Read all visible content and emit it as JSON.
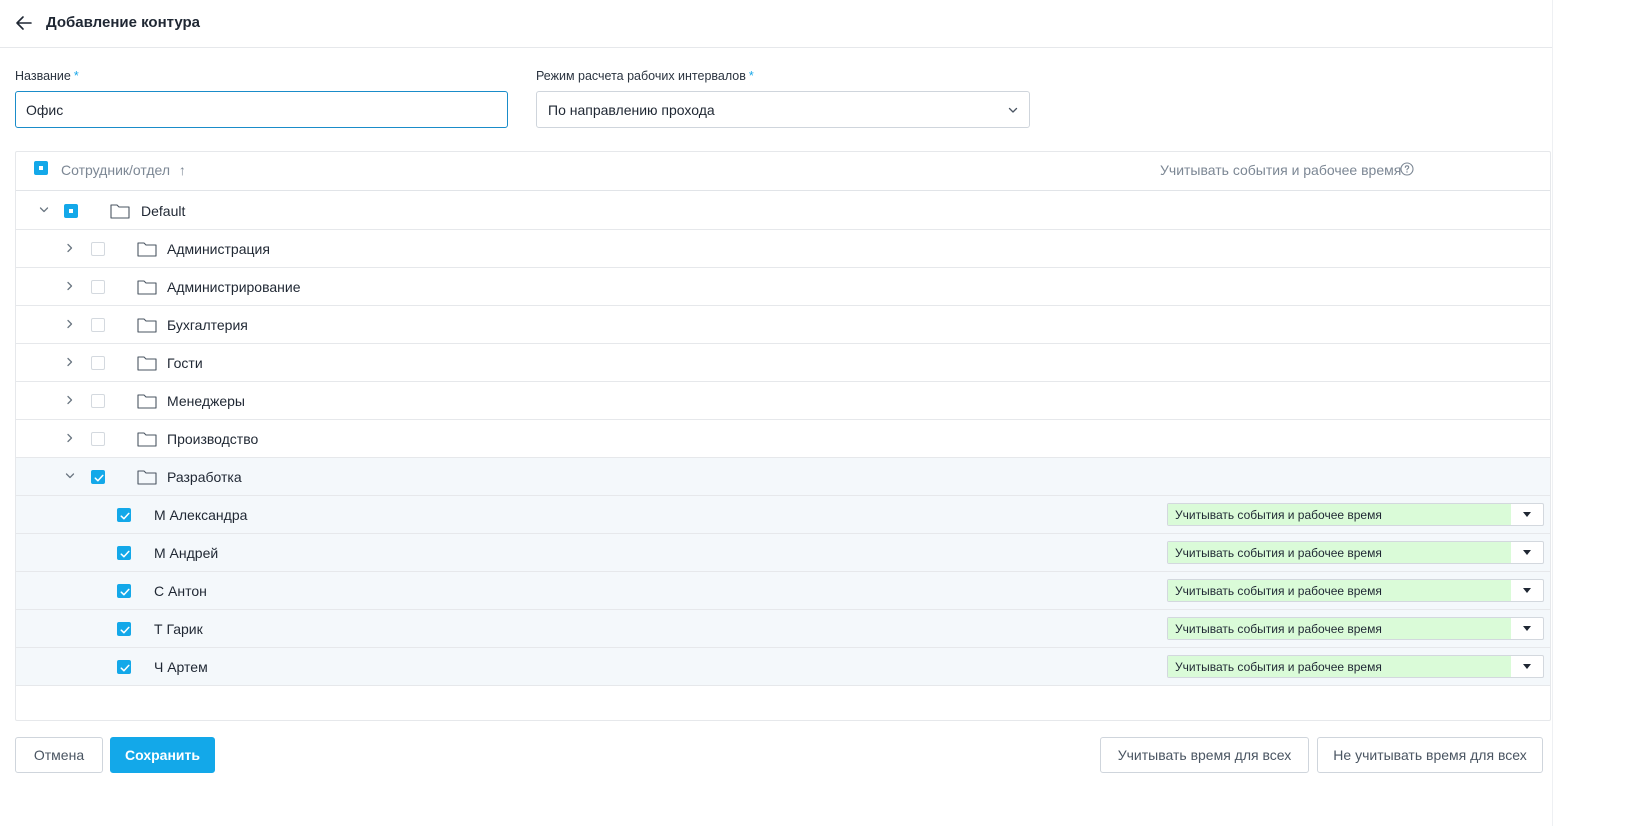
{
  "header": {
    "title": "Добавление контура"
  },
  "form": {
    "name_label": "Название",
    "name_value": "Офис",
    "mode_label": "Режим расчета рабочих интервалов",
    "mode_value": "По направлению прохода",
    "required_mark": "*"
  },
  "table": {
    "col_employee": "Сотрудник/отдел",
    "sort_indicator": "↑",
    "col_events": "Учитывать события и рабочее время",
    "root": {
      "label": "Default",
      "state": "partial",
      "expanded": true
    },
    "departments": [
      {
        "label": "Администрация",
        "state": "unchecked",
        "expanded": false
      },
      {
        "label": "Администрирование",
        "state": "unchecked",
        "expanded": false
      },
      {
        "label": "Бухгалтерия",
        "state": "unchecked",
        "expanded": false
      },
      {
        "label": "Гости",
        "state": "unchecked",
        "expanded": false
      },
      {
        "label": "Менеджеры",
        "state": "unchecked",
        "expanded": false
      },
      {
        "label": "Производство",
        "state": "unchecked",
        "expanded": false
      },
      {
        "label": "Разработка",
        "state": "checked",
        "expanded": true
      }
    ],
    "employees": [
      {
        "name": "М Александра",
        "mode": "Учитывать события и рабочее время"
      },
      {
        "name": "М Андрей",
        "mode": "Учитывать события и рабочее время"
      },
      {
        "name": "С Антон",
        "mode": "Учитывать события и рабочее время"
      },
      {
        "name": "Т Гарик",
        "mode": "Учитывать события и рабочее время"
      },
      {
        "name": "Ч Артем",
        "mode": "Учитывать события и рабочее время"
      }
    ]
  },
  "footer": {
    "cancel": "Отмена",
    "save": "Сохранить",
    "count_all": "Учитывать время для всех",
    "no_count_all": "Не учитывать время для всех"
  },
  "colors": {
    "accent": "#13a8e9",
    "input_focus": "#1a8cc9",
    "events_fill": "#dafbd8"
  },
  "icons": {
    "back": "arrow-left-icon",
    "chevron": "chevron-down-icon",
    "help": "question-circle-icon",
    "folder": "folder-icon",
    "expand": "chevron-right-icon",
    "collapse": "chevron-down-icon"
  }
}
